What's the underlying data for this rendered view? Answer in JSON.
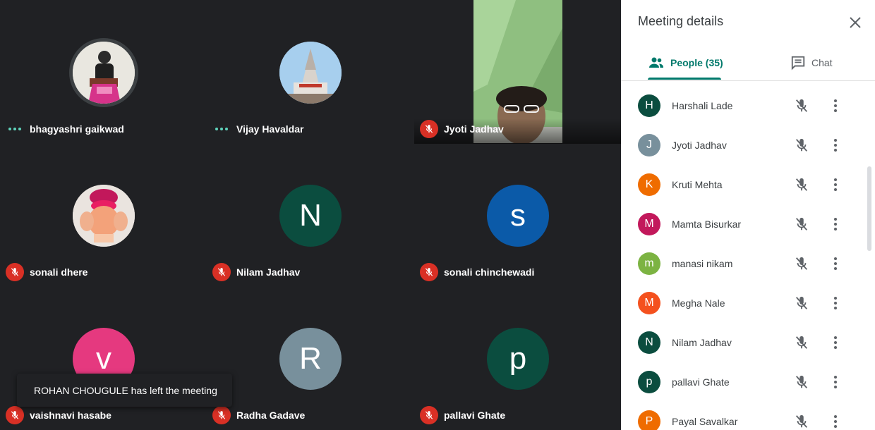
{
  "grid": {
    "tiles": [
      {
        "name": "bhagyashri gaikwad",
        "status": "speaking-dots",
        "avatar": "photo-person",
        "color": "#e8e6df"
      },
      {
        "name": "Vijay Havaldar",
        "status": "speaking-dots",
        "avatar": "photo-temple",
        "color": "#9ec9e8"
      },
      {
        "name": "Jyoti Jadhav",
        "status": "muted",
        "avatar": "video"
      },
      {
        "name": "sonali dhere",
        "status": "muted",
        "avatar": "photo-ganesha",
        "color": "#ece8e4"
      },
      {
        "name": "Nilam Jadhav",
        "status": "muted",
        "initial": "N",
        "color": "#0b4d3f"
      },
      {
        "name": "sonali chinchewadi",
        "status": "muted",
        "initial": "s",
        "color": "#0b5aa8"
      },
      {
        "name": "vaishnavi hasabe",
        "status": "muted",
        "initial": "v",
        "color": "#e5397f"
      },
      {
        "name": "Radha Gadave",
        "status": "muted",
        "initial": "R",
        "color": "#78909c"
      },
      {
        "name": "pallavi Ghate",
        "status": "muted",
        "initial": "p",
        "color": "#0b4d3f"
      }
    ]
  },
  "toast": {
    "message": "ROHAN CHOUGULE has left the meeting"
  },
  "panel": {
    "title": "Meeting details",
    "tabs": [
      {
        "label": "People (35)",
        "active": true
      },
      {
        "label": "Chat",
        "active": false
      }
    ],
    "people": [
      {
        "initial": "H",
        "name": "Harshali Lade",
        "color": "#0b4d3f"
      },
      {
        "initial": "J",
        "name": "Jyoti Jadhav",
        "color": "#78909c"
      },
      {
        "initial": "K",
        "name": "Kruti Mehta",
        "color": "#ef6c00"
      },
      {
        "initial": "M",
        "name": "Mamta Bisurkar",
        "color": "#c2185b"
      },
      {
        "initial": "m",
        "name": "manasi nikam",
        "color": "#7cb342"
      },
      {
        "initial": "M",
        "name": "Megha Nale",
        "color": "#f4511e"
      },
      {
        "initial": "N",
        "name": "Nilam Jadhav",
        "color": "#0b4d3f"
      },
      {
        "initial": "p",
        "name": "pallavi Ghate",
        "color": "#0b4d3f"
      },
      {
        "initial": "P",
        "name": "Payal Savalkar",
        "color": "#ef6c00"
      }
    ]
  },
  "colors": {
    "accent": "#00796b",
    "muted_red": "#d93025",
    "background": "#202124"
  }
}
